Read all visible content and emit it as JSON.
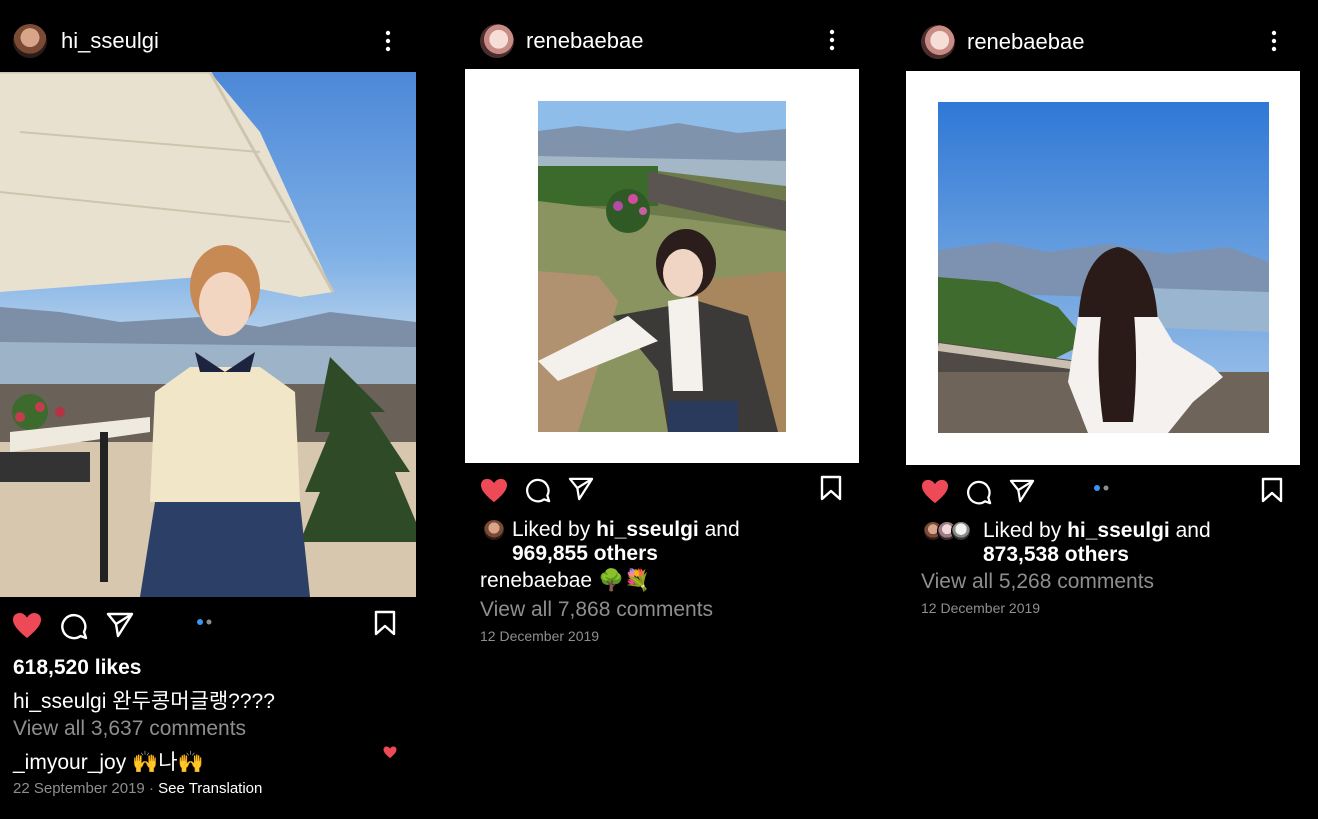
{
  "posts": [
    {
      "username": "hi_sseulgi",
      "likes_text": "618,520 likes",
      "caption_user": "hi_sseulgi",
      "caption_text": "완두콩머글랭????",
      "view_comments": "View all 3,637 comments",
      "comment_user": "_imyour_joy",
      "comment_text": "나",
      "date": "22 September 2019",
      "see_translation": "See Translation"
    },
    {
      "username": "renebaebae",
      "liked_by_prefix": "Liked by",
      "liked_by_user": "hi_sseulgi",
      "liked_by_and": "and",
      "liked_by_others": "969,855 others",
      "caption_user": "renebaebae",
      "view_comments": "View all 7,868 comments",
      "date": "12 December 2019"
    },
    {
      "username": "renebaebae",
      "liked_by_prefix": "Liked by",
      "liked_by_user": "hi_sseulgi",
      "liked_by_and": "and",
      "liked_by_others": "873,538 others",
      "view_comments": "View all 5,268 comments",
      "date": "12 December 2019"
    }
  ],
  "colors": {
    "heart": "#ed4956",
    "carousel_dot": "#3897f0",
    "grey_text": "#8e8e8e"
  }
}
